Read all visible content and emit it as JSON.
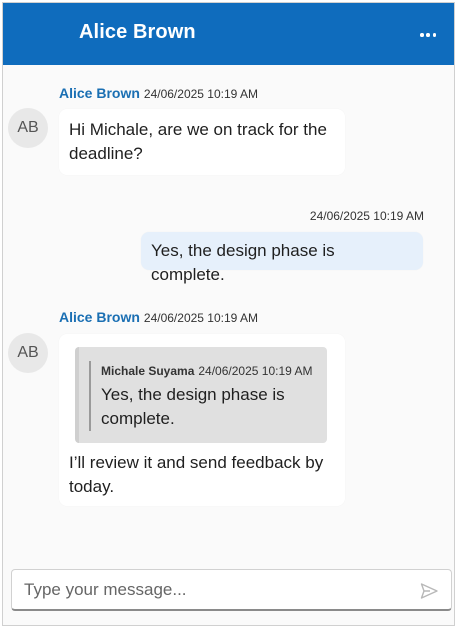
{
  "header": {
    "title": "Alice Brown",
    "more_icon": "more-horizontal-icon",
    "background": "#0f6cbd"
  },
  "messages": [
    {
      "avatar_initials": "AB",
      "sender": "Alice Brown",
      "time": "24/06/2025 10:19 AM",
      "text": "Hi Michale, are we on track for the deadline?"
    },
    {
      "time": "24/06/2025 10:19 AM",
      "text": "Yes, the design phase is complete."
    },
    {
      "avatar_initials": "AB",
      "sender": "Alice Brown",
      "time": "24/06/2025 10:19 AM",
      "quote": {
        "sender": "Michale Suyama",
        "time": "24/06/2025 10:19 AM",
        "text": "Yes, the design phase is complete."
      },
      "text": "I’ll review it and send feedback by today."
    }
  ],
  "composer": {
    "placeholder": "Type your message...",
    "send_icon": "send-icon"
  },
  "colors": {
    "accent": "#0f6cbd",
    "sender_name": "#1a6fb3",
    "sent_bubble": "#e6f0fb"
  }
}
